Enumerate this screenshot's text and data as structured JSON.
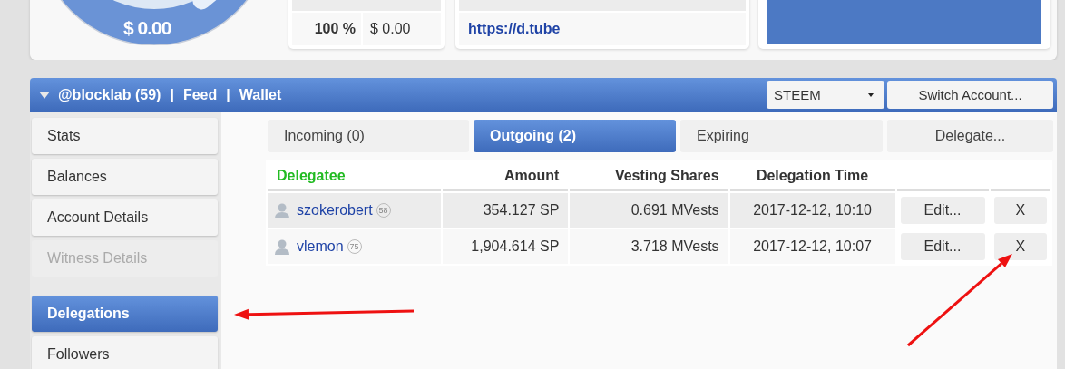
{
  "summary": {
    "total": "$ 0.00",
    "vote_table": [
      {
        "percent": "100 %",
        "value": "$ 0.00"
      }
    ],
    "links": [
      "https://d.tube"
    ]
  },
  "account": {
    "name": "@blocklab (59)",
    "separator": "|",
    "links": [
      "Feed",
      "Wallet"
    ],
    "currency": "STEEM",
    "switch_button": "Switch Account..."
  },
  "sidebar": {
    "groups": [
      [
        {
          "label": "Stats",
          "selected": false,
          "disabled": false
        },
        {
          "label": "Balances",
          "selected": false,
          "disabled": false
        },
        {
          "label": "Account Details",
          "selected": false,
          "disabled": false
        },
        {
          "label": "Witness Details",
          "selected": false,
          "disabled": true
        }
      ],
      [
        {
          "label": "Delegations",
          "selected": true,
          "disabled": false
        },
        {
          "label": "Followers",
          "selected": false,
          "disabled": false
        }
      ]
    ]
  },
  "tabs": [
    {
      "label": "Incoming (0)",
      "selected": false
    },
    {
      "label": "Outgoing (2)",
      "selected": true
    },
    {
      "label": "Expiring",
      "selected": false
    },
    {
      "label": "Delegate...",
      "selected": false
    }
  ],
  "table": {
    "columns": [
      "Delegatee",
      "Amount",
      "Vesting Shares",
      "Delegation Time"
    ],
    "rows": [
      {
        "delegatee": "szokerobert",
        "reputation": "58",
        "amount": "354.127 SP",
        "vesting_shares": "0.691 MVests",
        "time": "2017-12-12, 10:10",
        "edit_button": "Edit...",
        "remove_button": "X"
      },
      {
        "delegatee": "vlemon",
        "reputation": "75",
        "amount": "1,904.614 SP",
        "vesting_shares": "3.718 MVests",
        "time": "2017-12-12, 10:07",
        "edit_button": "Edit...",
        "remove_button": "X"
      }
    ]
  }
}
